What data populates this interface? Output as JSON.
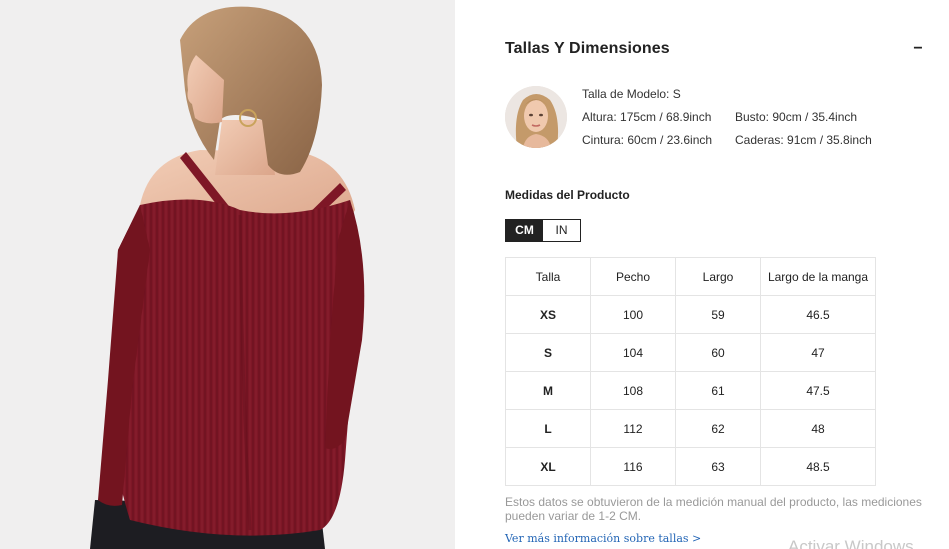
{
  "sizing": {
    "title": "Tallas Y Dimensiones",
    "collapse_icon": "minus-icon",
    "collapse_symbol": "−"
  },
  "model": {
    "size_line": "Talla de Modelo: S",
    "height": "Altura: 175cm / 68.9inch",
    "bust": "Busto: 90cm / 35.4inch",
    "waist": "Cintura: 60cm / 23.6inch",
    "hips": "Caderas: 91cm / 35.8inch"
  },
  "measurements": {
    "title": "Medidas del Producto",
    "units": [
      {
        "label": "CM",
        "active": true
      },
      {
        "label": "IN",
        "active": false
      }
    ],
    "headers": [
      "Talla",
      "Pecho",
      "Largo",
      "Largo de la manga"
    ],
    "rows": [
      [
        "XS",
        "100",
        "59",
        "46.5"
      ],
      [
        "S",
        "104",
        "60",
        "47"
      ],
      [
        "M",
        "108",
        "61",
        "47.5"
      ],
      [
        "L",
        "112",
        "62",
        "48"
      ],
      [
        "XL",
        "116",
        "63",
        "48.5"
      ]
    ]
  },
  "disclaimer": "Estos datos se obtuvieron de la medición manual del producto, las mediciones pueden variar de 1-2 CM.",
  "more_link": "Ver más información sobre tallas >",
  "watermark": "Activar Windows",
  "colors": {
    "sweater": "#7e1726",
    "accent_link": "#2466b6",
    "active_unit_bg": "#222222"
  }
}
